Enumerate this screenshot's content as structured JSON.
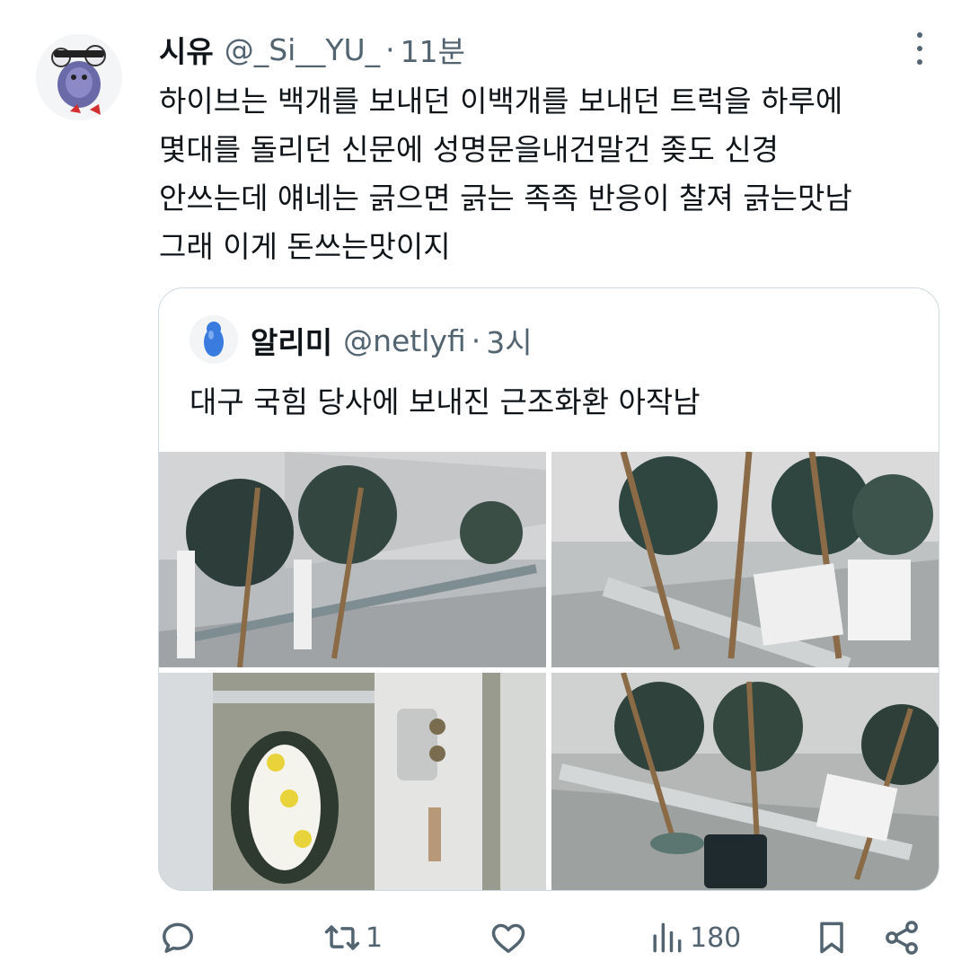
{
  "tweet": {
    "author_name": "시유",
    "author_handle": "@_Si__YU_",
    "separator": "·",
    "time": "11분",
    "lines": [
      "하이브는 백개를 보내던 이백개를 보내던 트럭을 하루에",
      "몇대를 돌리던 신문에 성명문을내건말건 좆도 신경",
      "안쓰는데 얘네는 긁으면 긁는 족족 반응이 찰져 긁는맛남",
      "그래 이게 돈쓰는맛이지"
    ]
  },
  "quote": {
    "author_name": "알리미",
    "author_handle": "@netlyfi",
    "separator": "·",
    "time": "3시",
    "text": "대구 국힘 당사에 보내진 근조화환 아작남"
  },
  "actions": {
    "reply_icon": "reply-icon",
    "retweet_icon": "retweet-icon",
    "retweet_count": "1",
    "like_icon": "heart-icon",
    "views_icon": "views-icon",
    "views_count": "180",
    "bookmark_icon": "bookmark-icon",
    "share_icon": "share-icon"
  },
  "colors": {
    "text_primary": "#0f1419",
    "text_secondary": "#536471",
    "border": "#cfd9de"
  }
}
